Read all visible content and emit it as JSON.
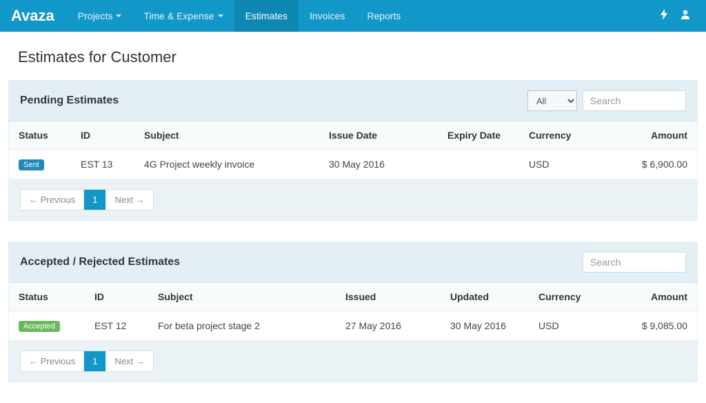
{
  "brand": "Avaza",
  "nav": {
    "items": [
      {
        "label": "Projects",
        "dropdown": true,
        "active": false
      },
      {
        "label": "Time & Expense",
        "dropdown": true,
        "active": false
      },
      {
        "label": "Estimates",
        "dropdown": false,
        "active": true
      },
      {
        "label": "Invoices",
        "dropdown": false,
        "active": false
      },
      {
        "label": "Reports",
        "dropdown": false,
        "active": false
      }
    ]
  },
  "page_title": "Estimates for Customer",
  "pending": {
    "title": "Pending Estimates",
    "filter_value": "All",
    "search_placeholder": "Search",
    "columns": {
      "status": "Status",
      "id": "ID",
      "subject": "Subject",
      "issue_date": "Issue Date",
      "expiry_date": "Expiry Date",
      "currency": "Currency",
      "amount": "Amount"
    },
    "rows": [
      {
        "status_label": "Sent",
        "status_class": "badge-sent",
        "id": "EST 13",
        "subject": "4G Project weekly invoice",
        "issue_date": "30 May 2016",
        "expiry_date": "",
        "currency": "USD",
        "amount": "$ 6,900.00"
      }
    ]
  },
  "accepted": {
    "title": "Accepted / Rejected Estimates",
    "search_placeholder": "Search",
    "columns": {
      "status": "Status",
      "id": "ID",
      "subject": "Subject",
      "issued": "Issued",
      "updated": "Updated",
      "currency": "Currency",
      "amount": "Amount"
    },
    "rows": [
      {
        "status_label": "Accepted",
        "status_class": "badge-accepted",
        "id": "EST 12",
        "subject": "For beta project stage 2",
        "issued": "27 May 2016",
        "updated": "30 May 2016",
        "currency": "USD",
        "amount": "$ 9,085.00"
      }
    ]
  },
  "pagination": {
    "prev": "← Previous",
    "page": "1",
    "next": "Next →"
  }
}
